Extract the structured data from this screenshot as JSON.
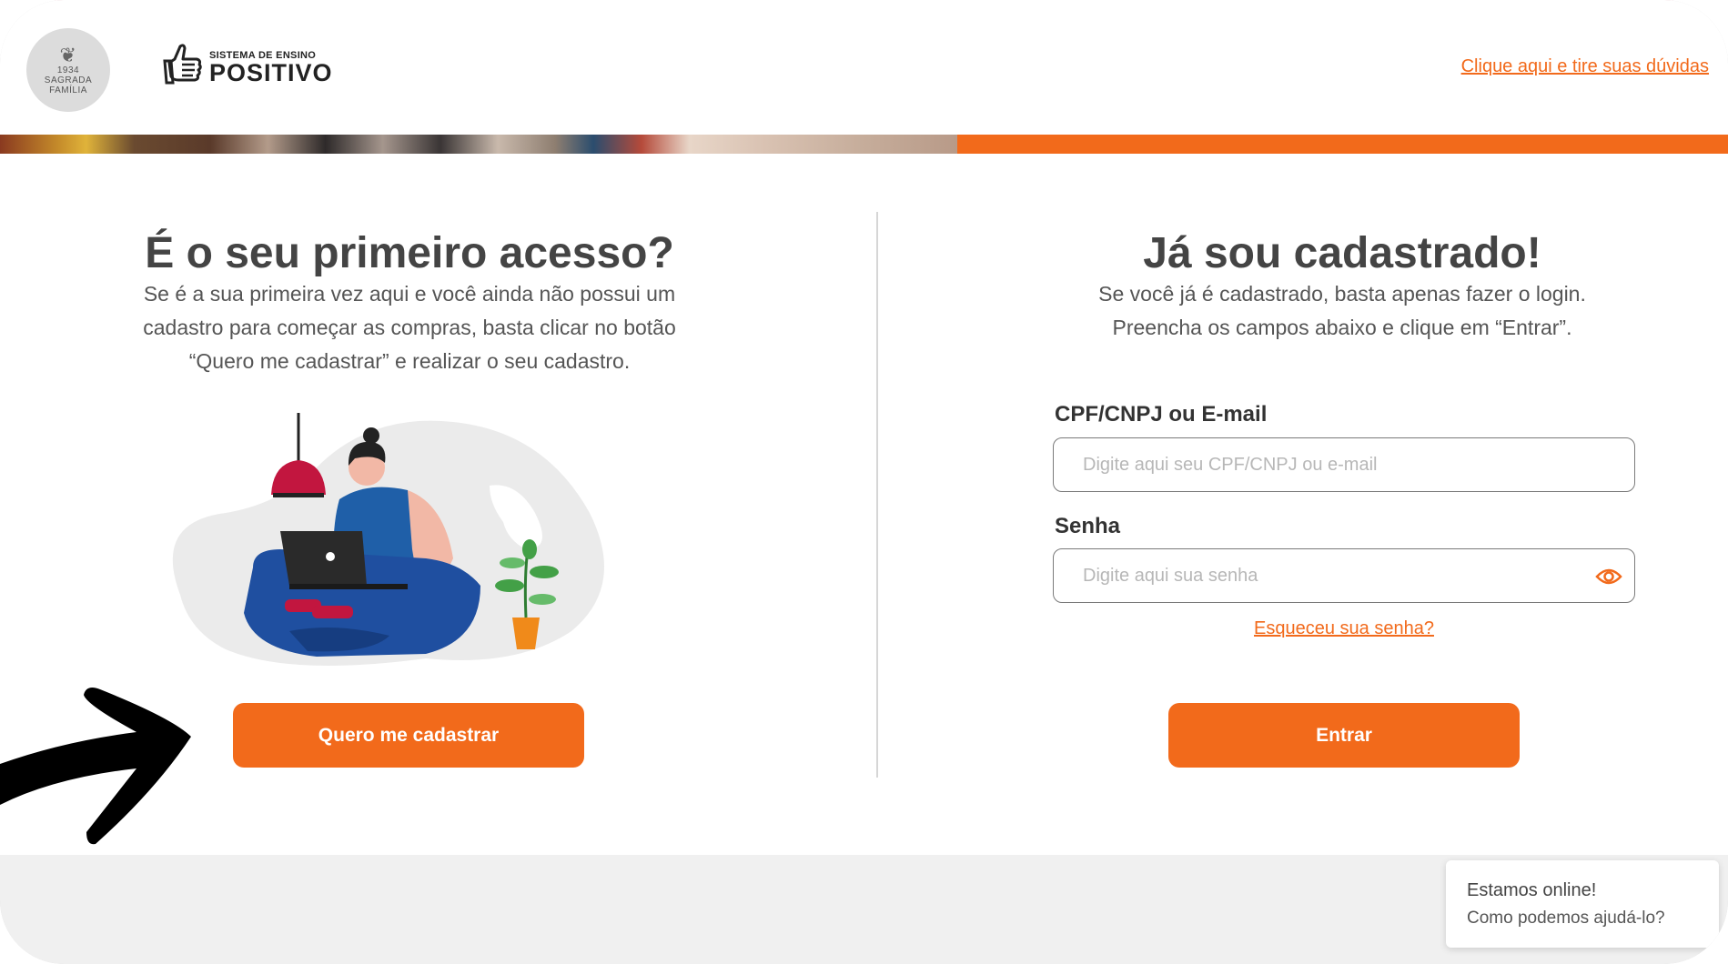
{
  "header": {
    "seal_lines": [
      "1934",
      "SAGRADA",
      "FAMÍLIA"
    ],
    "brand_small": "SISTEMA DE ENSINO",
    "brand_big": "POSITIVO",
    "help_link": "Clique aqui e tire suas dúvidas"
  },
  "left": {
    "title": "É o seu primeiro acesso?",
    "text_lines": [
      "Se é a sua primeira vez aqui e você ainda não possui um",
      "cadastro para começar as compras, basta clicar no botão",
      "“Quero me cadastrar” e realizar o seu cadastro."
    ],
    "register_button": "Quero me cadastrar"
  },
  "right": {
    "title": "Já sou cadastrado!",
    "text_lines": [
      "Se você já é cadastrado, basta apenas fazer o login.",
      "Preencha os campos abaixo e clique em “Entrar”."
    ],
    "cpf_label": "CPF/CNPJ ou E-mail",
    "cpf_placeholder": "Digite aqui seu CPF/CNPJ ou e-mail",
    "password_label": "Senha",
    "password_placeholder": "Digite aqui sua senha",
    "forgot_link": "Esqueceu sua senha?",
    "login_button": "Entrar"
  },
  "chat": {
    "line1": "Estamos online!",
    "line2": "Como podemos ajudá-lo?"
  },
  "colors": {
    "accent": "#f26a1b",
    "title_text": "#444444",
    "footer_bg": "#f0f0f0"
  },
  "icons": [
    "hand-logo-icon",
    "eye-icon",
    "arrow-pointer"
  ]
}
